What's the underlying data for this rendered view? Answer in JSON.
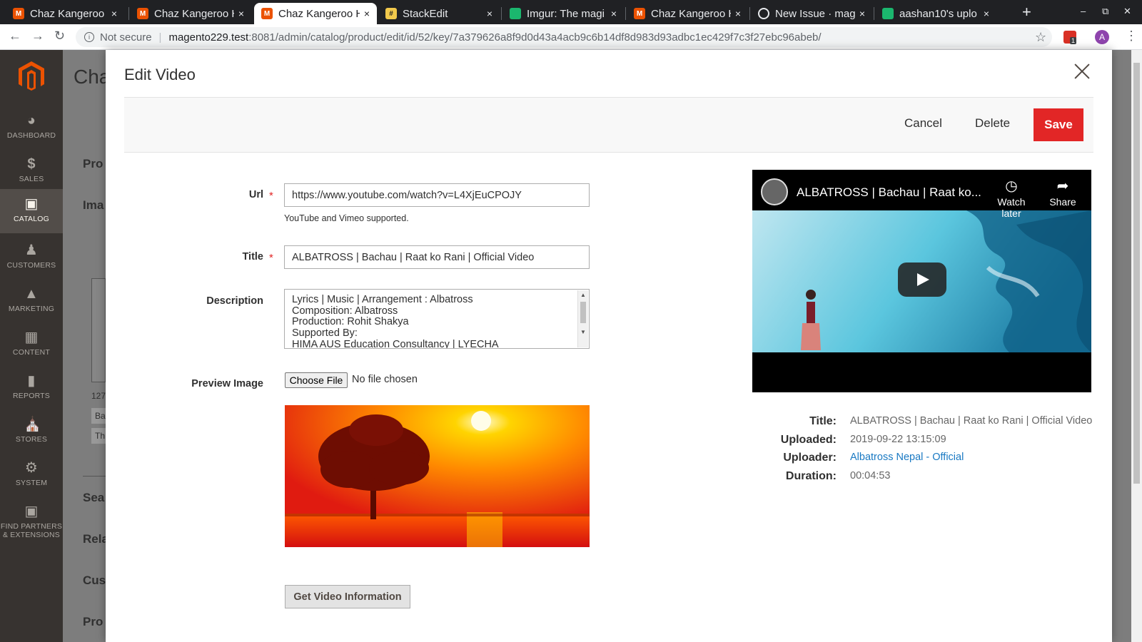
{
  "browser": {
    "tabs": [
      {
        "title": "Chaz Kangeroo H",
        "icon": "magento-icon",
        "active": false
      },
      {
        "title": "Chaz Kangeroo H",
        "icon": "magento-icon",
        "active": false
      },
      {
        "title": "Chaz Kangeroo H",
        "icon": "magento-icon",
        "active": true
      },
      {
        "title": "StackEdit",
        "icon": "stackedit-icon",
        "active": false
      },
      {
        "title": "Imgur: The magi",
        "icon": "imgur-icon",
        "active": false
      },
      {
        "title": "Chaz Kangeroo H",
        "icon": "magento-icon",
        "active": false
      },
      {
        "title": "New Issue · mag",
        "icon": "github-icon",
        "active": false
      },
      {
        "title": "aashan10's uplo",
        "icon": "imgur-icon",
        "active": false
      }
    ],
    "close_glyph": "×",
    "new_tab_glyph": "+",
    "address": {
      "security": "Not secure",
      "host": "magento229.test",
      "path": ":8081/admin/catalog/product/edit/id/52/key/7a379626a8f9d0d43a4acb9c6b14df8d983d93adbc1ec429f7c3f27ebc96abeb/"
    },
    "extension_badge": "1",
    "profile_initial": "A"
  },
  "admin": {
    "sidebar": [
      {
        "label": "DASHBOARD",
        "icon": "dashboard-icon"
      },
      {
        "label": "SALES",
        "icon": "dollar-icon"
      },
      {
        "label": "CATALOG",
        "icon": "box-icon",
        "active": true
      },
      {
        "label": "CUSTOMERS",
        "icon": "person-icon"
      },
      {
        "label": "MARKETING",
        "icon": "megaphone-icon"
      },
      {
        "label": "CONTENT",
        "icon": "layout-icon"
      },
      {
        "label": "REPORTS",
        "icon": "bar-chart-icon"
      },
      {
        "label": "STORES",
        "icon": "store-icon"
      },
      {
        "label": "SYSTEM",
        "icon": "gear-icon"
      },
      {
        "label": "FIND PARTNERS & EXTENSIONS",
        "icon": "cube-icon"
      }
    ],
    "background": {
      "page_title": "Cha",
      "sections": [
        "Pro",
        "Ima",
        "Sea",
        "Rela",
        "Cus",
        "Pro"
      ],
      "fragments": [
        "127",
        "Ba",
        "Th"
      ]
    }
  },
  "modal": {
    "title": "Edit Video",
    "actions": {
      "cancel": "Cancel",
      "delete": "Delete",
      "save": "Save"
    },
    "form": {
      "url": {
        "label": "Url",
        "value": "https://www.youtube.com/watch?v=L4XjEuCPOJY",
        "note": "YouTube and Vimeo supported."
      },
      "title": {
        "label": "Title",
        "value": "ALBATROSS | Bachau | Raat ko Rani | Official Video"
      },
      "description": {
        "label": "Description",
        "lines": [
          "Lyrics | Music | Arrangement : Albatross",
          "Composition: Albatross",
          "Production: Rohit Shakya",
          "Supported By:",
          "HIMA AUS Education Consultancy | LYECHA"
        ]
      },
      "preview_image": {
        "label": "Preview Image",
        "button": "Choose File",
        "status": "No file chosen"
      },
      "get_info_button": "Get Video Information"
    },
    "video": {
      "title": "ALBATROSS | Bachau | Raat ko...",
      "watch_later": "Watch later",
      "share": "Share"
    },
    "info": [
      {
        "label": "Title:",
        "value": "ALBATROSS | Bachau | Raat ko Rani | Official Video"
      },
      {
        "label": "Uploaded:",
        "value": "2019-09-22 13:15:09"
      },
      {
        "label": "Uploader:",
        "value": "Albatross Nepal - Official",
        "link": true
      },
      {
        "label": "Duration:",
        "value": "00:04:53"
      }
    ],
    "colors": {
      "save": "#e22626",
      "link": "#1979c3",
      "required": "#e22626"
    }
  }
}
